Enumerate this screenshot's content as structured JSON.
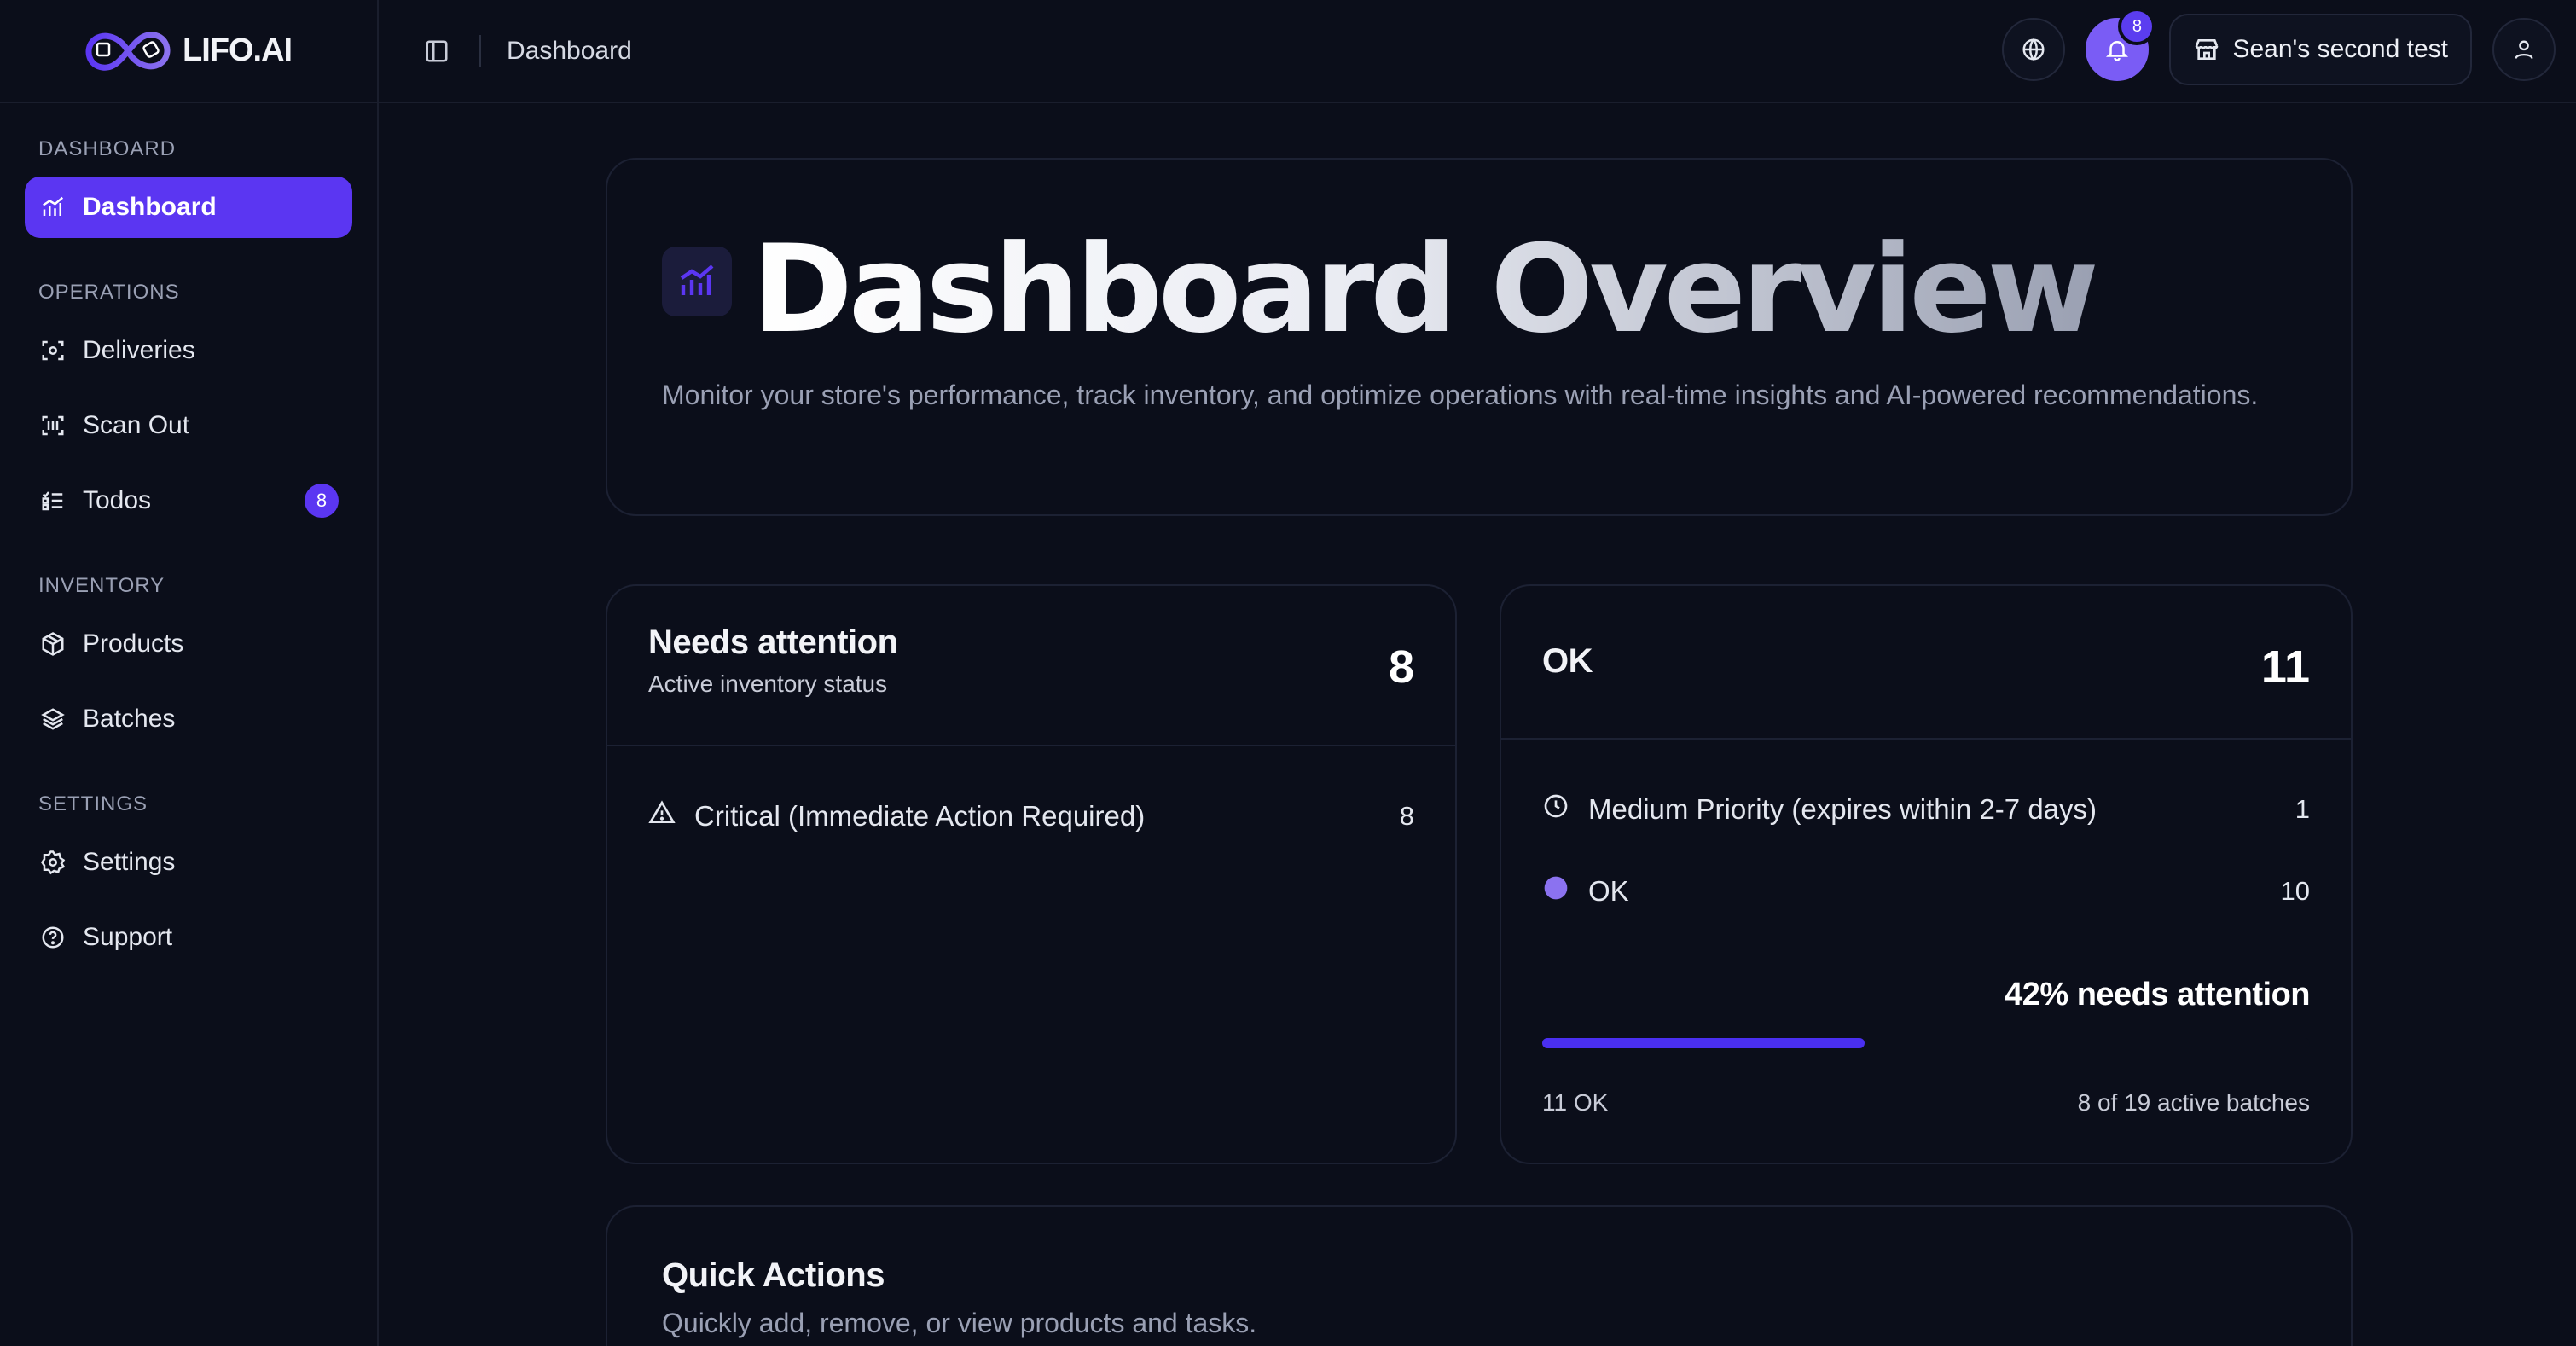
{
  "brand": {
    "name": "LIFO.AI"
  },
  "header": {
    "breadcrumb": "Dashboard",
    "notifications_count": "8",
    "store_name": "Sean's second test"
  },
  "sidebar": {
    "sections": [
      {
        "label": "DASHBOARD"
      },
      {
        "label": "OPERATIONS"
      },
      {
        "label": "INVENTORY"
      },
      {
        "label": "SETTINGS"
      }
    ],
    "items": [
      {
        "label": "Dashboard",
        "icon": "chart-icon"
      },
      {
        "label": "Deliveries",
        "icon": "scan-frame-icon"
      },
      {
        "label": "Scan Out",
        "icon": "barcode-scan-icon"
      },
      {
        "label": "Todos",
        "icon": "checklist-icon",
        "badge": "8"
      },
      {
        "label": "Products",
        "icon": "box-icon"
      },
      {
        "label": "Batches",
        "icon": "layers-icon"
      },
      {
        "label": "Settings",
        "icon": "gear-icon"
      },
      {
        "label": "Support",
        "icon": "help-circle-icon"
      }
    ]
  },
  "hero": {
    "title": "Dashboard Overview",
    "subtitle": "Monitor your store's performance, track inventory, and optimize operations with real-time insights and AI-powered recommendations."
  },
  "needs_attention": {
    "title": "Needs attention",
    "subtitle": "Active inventory status",
    "count": "8",
    "rows": [
      {
        "label": "Critical (Immediate Action Required)",
        "value": "8",
        "icon": "warning-triangle-icon"
      }
    ]
  },
  "ok_card": {
    "title": "OK",
    "count": "11",
    "rows": [
      {
        "label": "Medium Priority (expires within 2-7 days)",
        "value": "1",
        "icon": "clock-icon"
      },
      {
        "label": "OK",
        "value": "10",
        "icon": "dot-icon"
      }
    ],
    "attention_text": "42% needs attention",
    "progress_percent": 42,
    "footer_left": "11 OK",
    "footer_right": "8 of 19 active batches"
  },
  "quick_actions": {
    "title": "Quick Actions",
    "subtitle": "Quickly add, remove, or view products and tasks."
  },
  "colors": {
    "accent": "#5b36f2",
    "background": "#0b0e1a",
    "dot": "#8b72f0"
  }
}
